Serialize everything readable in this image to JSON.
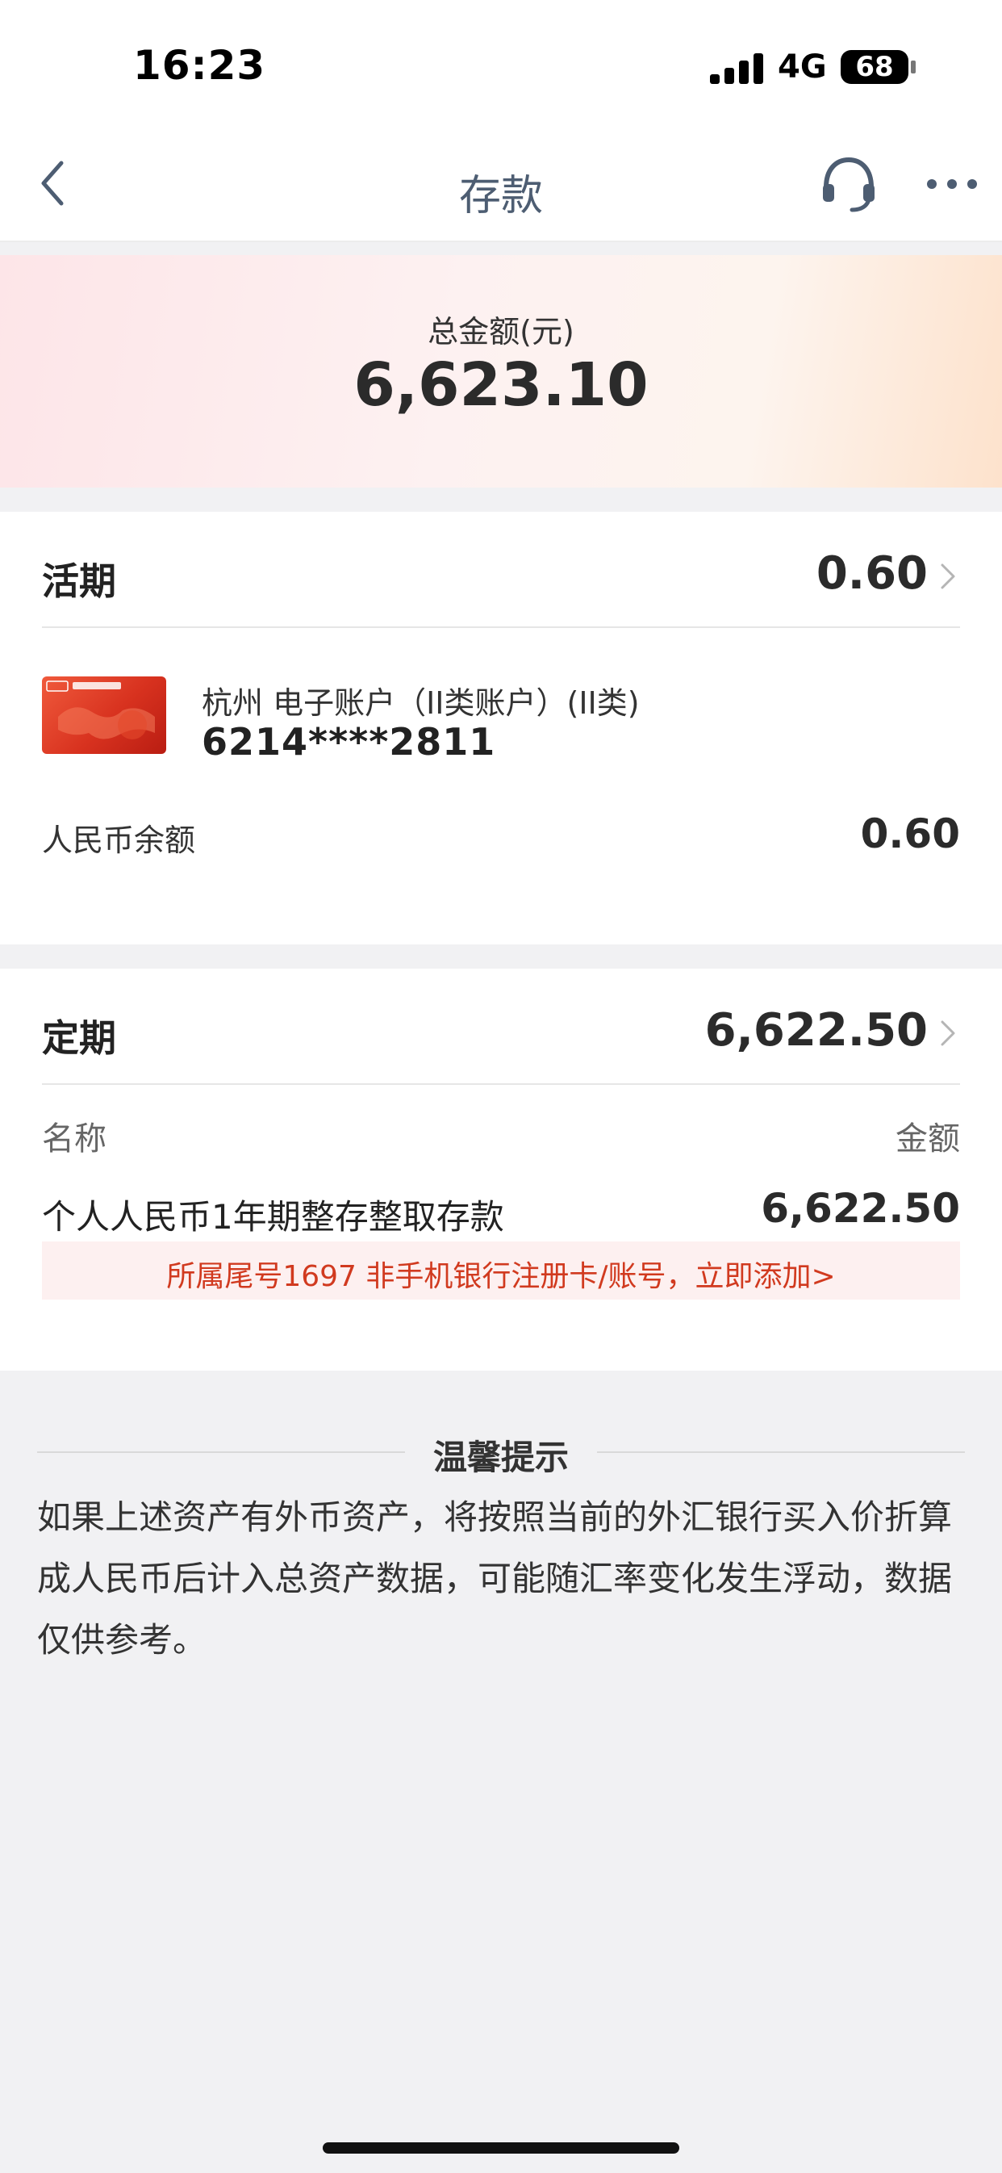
{
  "status_bar": {
    "time": "16:23",
    "network": "4G",
    "battery": "68"
  },
  "nav": {
    "title": "存款",
    "back_icon": "chevron-left-icon",
    "service_icon": "headset-icon",
    "more_icon": "ellipsis-icon"
  },
  "total": {
    "label": "总金额(元)",
    "value": "6,623.10"
  },
  "current": {
    "title": "活期",
    "amount": "0.60",
    "account": {
      "name": "杭州 电子账户（II类账户）(II类)",
      "number": "6214****2811",
      "card_icon": "icbc-card-icon"
    },
    "balance_label": "人民币余额",
    "balance_value": "0.60"
  },
  "fixed": {
    "title": "定期",
    "amount": "6,622.50",
    "columns": {
      "name": "名称",
      "amount": "金额"
    },
    "items": [
      {
        "name": "个人人民币1年期整存整取存款",
        "amount": "6,622.50"
      }
    ],
    "notice": "所属尾号1697 非手机银行注册卡/账号，立即添加>"
  },
  "tips": {
    "title": "温馨提示",
    "body": "如果上述资产有外币资产，将按照当前的外汇银行买入价折算成人民币后计入总资产数据，可能随汇率变化发生浮动，数据仅供参考。"
  },
  "colors": {
    "accent_red": "#d13a1f",
    "nav_title": "#4d5d72",
    "card_red": "#d8321f"
  }
}
